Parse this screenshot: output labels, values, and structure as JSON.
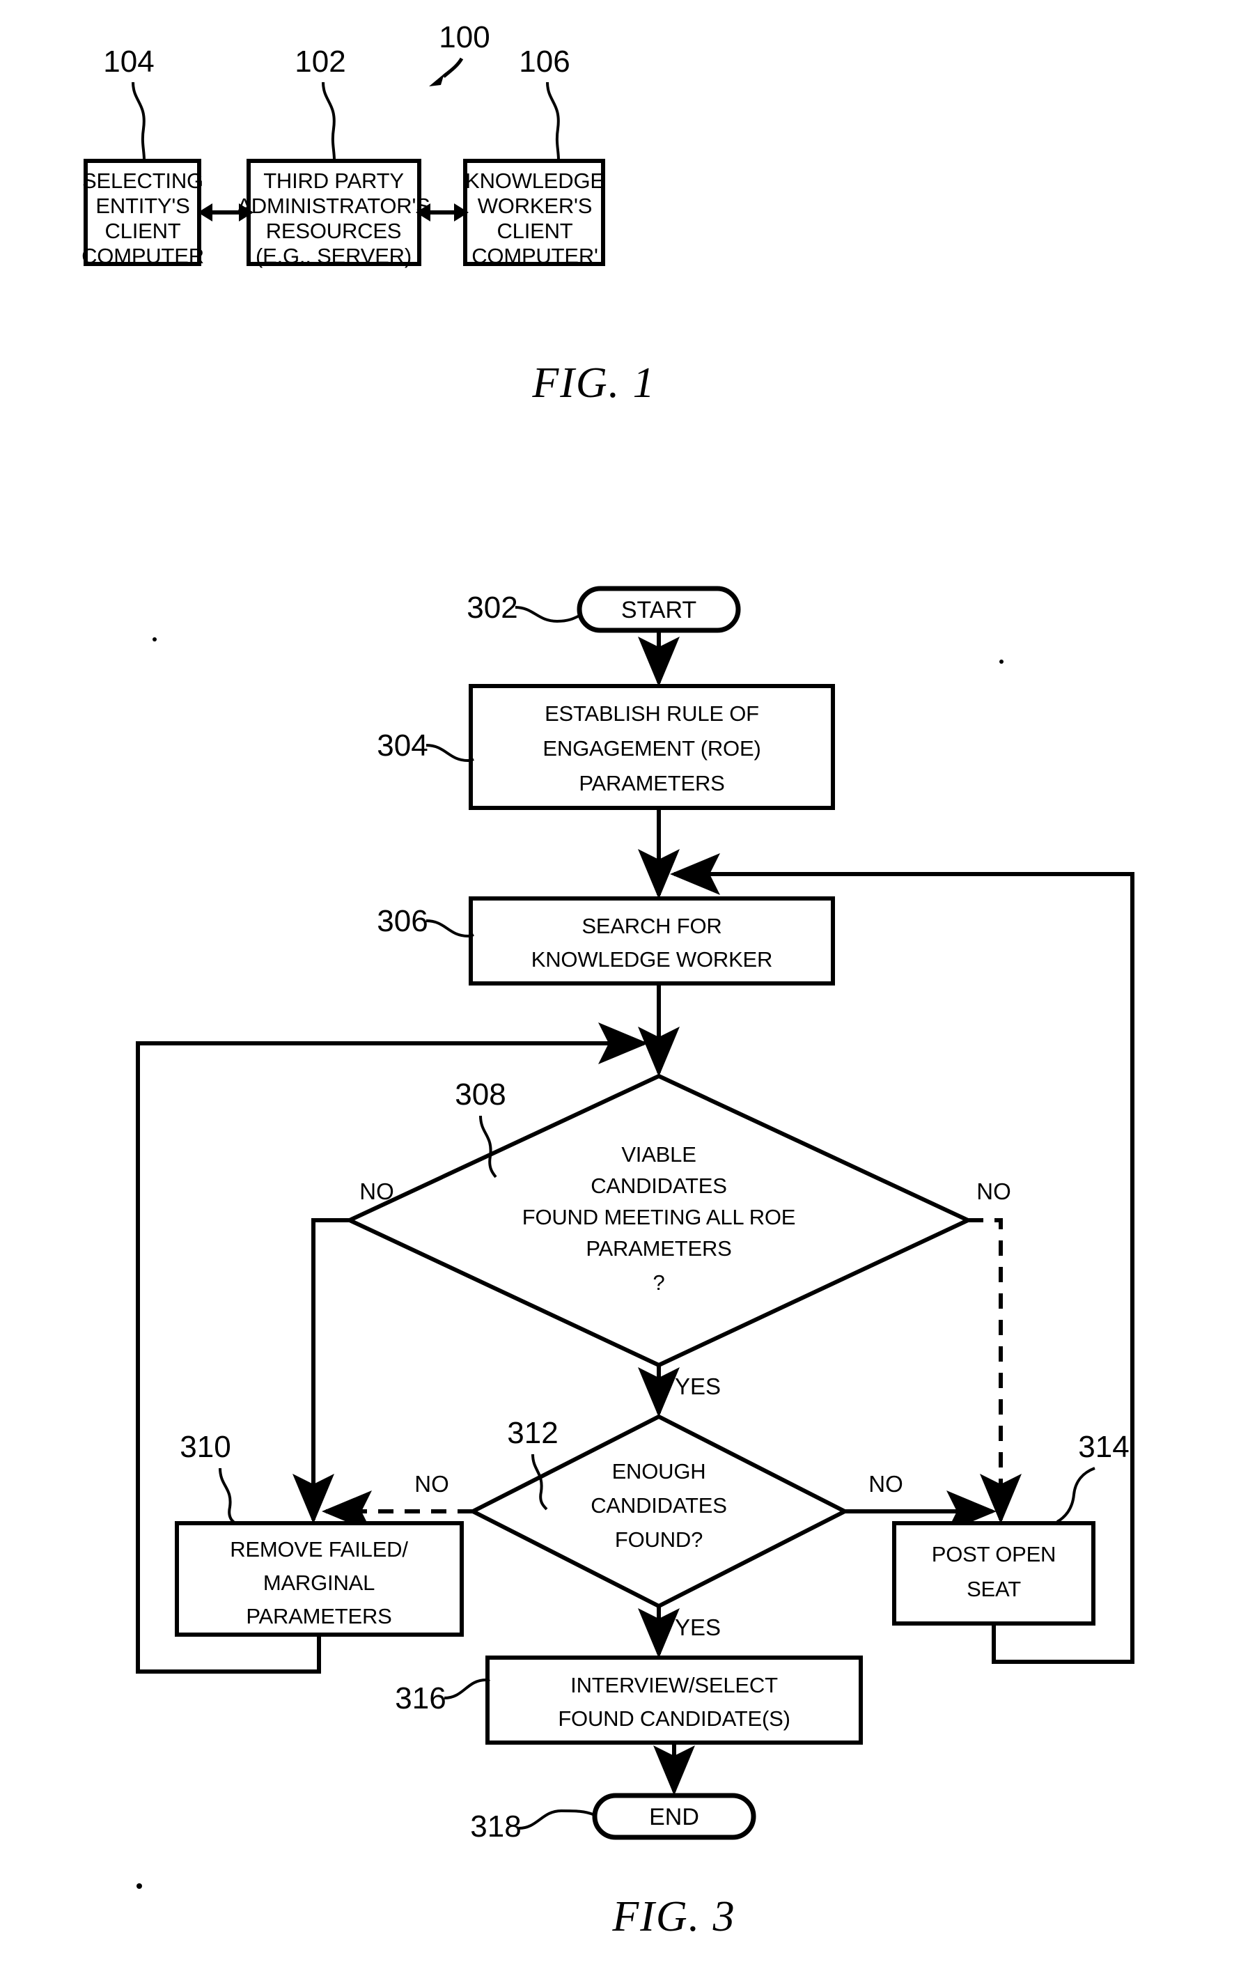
{
  "figure1": {
    "caption": "FIG. 1",
    "system_ref": "100",
    "nodes": [
      {
        "ref": "104",
        "name": "selecting-entity-client-computer",
        "lines": [
          "SELECTING",
          "ENTITY'S",
          "CLIENT",
          "COMPUTER"
        ]
      },
      {
        "ref": "102",
        "name": "third-party-administrator-resources",
        "lines": [
          "THIRD PARTY",
          "ADMINISTRATOR'S",
          "RESOURCES",
          "(E.G., SERVER)"
        ]
      },
      {
        "ref": "106",
        "name": "knowledge-worker-client-computer",
        "lines": [
          "KNOWLEDGE",
          "WORKER'S",
          "CLIENT",
          "COMPUTER'"
        ]
      }
    ]
  },
  "figure3": {
    "caption": "FIG. 3",
    "nodes": [
      {
        "ref": "302",
        "name": "start-terminator",
        "shape": "terminator",
        "lines": [
          "START"
        ]
      },
      {
        "ref": "304",
        "name": "establish-roe-parameters",
        "shape": "process",
        "lines": [
          "ESTABLISH RULE OF",
          "ENGAGEMENT (ROE)",
          "PARAMETERS"
        ]
      },
      {
        "ref": "306",
        "name": "search-for-knowledge-worker",
        "shape": "process",
        "lines": [
          "SEARCH FOR",
          "KNOWLEDGE WORKER"
        ]
      },
      {
        "ref": "308",
        "name": "viable-candidates-decision",
        "shape": "decision",
        "lines": [
          "VIABLE",
          "CANDIDATES",
          "FOUND MEETING ALL ROE",
          "PARAMETERS",
          "?"
        ]
      },
      {
        "ref": "310",
        "name": "remove-failed-marginal-parameters",
        "shape": "process",
        "lines": [
          "REMOVE FAILED/",
          "MARGINAL",
          "PARAMETERS"
        ]
      },
      {
        "ref": "312",
        "name": "enough-candidates-decision",
        "shape": "decision",
        "lines": [
          "ENOUGH",
          "CANDIDATES",
          "FOUND?"
        ]
      },
      {
        "ref": "314",
        "name": "post-open-seat",
        "shape": "process",
        "lines": [
          "POST OPEN",
          "SEAT"
        ]
      },
      {
        "ref": "316",
        "name": "interview-select-found-candidates",
        "shape": "process",
        "lines": [
          "INTERVIEW/SELECT",
          "FOUND CANDIDATE(S)"
        ]
      },
      {
        "ref": "318",
        "name": "end-terminator",
        "shape": "terminator",
        "lines": [
          "END"
        ]
      }
    ],
    "edge_labels": {
      "d308_no_left": "NO",
      "d308_no_right": "NO",
      "d308_yes": "YES",
      "d312_no_left": "NO",
      "d312_no_right": "NO",
      "d312_yes": "YES"
    }
  },
  "text": {
    "fig1_n104_l1": "SELECTING",
    "fig1_n104_l2": "ENTITY'S",
    "fig1_n104_l3": "CLIENT",
    "fig1_n104_l4": "COMPUTER",
    "fig1_n102_l1": "THIRD PARTY",
    "fig1_n102_l2": "ADMINISTRATOR'S",
    "fig1_n102_l3": "RESOURCES",
    "fig1_n102_l4": "(E.G., SERVER)",
    "fig1_n106_l1": "KNOWLEDGE",
    "fig1_n106_l2": "WORKER'S",
    "fig1_n106_l3": "CLIENT",
    "fig1_n106_l4": "COMPUTER'",
    "ref_100": "100",
    "ref_102": "102",
    "ref_104": "104",
    "ref_106": "106",
    "fig1_caption": "FIG. 1",
    "n302_l1": "START",
    "n304_l1": "ESTABLISH RULE OF",
    "n304_l2": "ENGAGEMENT (ROE)",
    "n304_l3": "PARAMETERS",
    "n306_l1": "SEARCH FOR",
    "n306_l2": "KNOWLEDGE WORKER",
    "n308_l1": "VIABLE",
    "n308_l2": "CANDIDATES",
    "n308_l3": "FOUND MEETING ALL ROE",
    "n308_l4": "PARAMETERS",
    "n308_l5": "?",
    "n310_l1": "REMOVE FAILED/",
    "n310_l2": "MARGINAL",
    "n310_l3": "PARAMETERS",
    "n312_l1": "ENOUGH",
    "n312_l2": "CANDIDATES",
    "n312_l3": "FOUND?",
    "n314_l1": "POST OPEN",
    "n314_l2": "SEAT",
    "n316_l1": "INTERVIEW/SELECT",
    "n316_l2": "FOUND CANDIDATE(S)",
    "n318_l1": "END",
    "ref_302": "302",
    "ref_304": "304",
    "ref_306": "306",
    "ref_308": "308",
    "ref_310": "310",
    "ref_312": "312",
    "ref_314": "314",
    "ref_316": "316",
    "ref_318": "318",
    "lbl_no_a": "NO",
    "lbl_no_b": "NO",
    "lbl_yes_a": "YES",
    "lbl_no_c": "NO",
    "lbl_no_d": "NO",
    "lbl_yes_b": "YES",
    "fig3_caption": "FIG. 3"
  }
}
